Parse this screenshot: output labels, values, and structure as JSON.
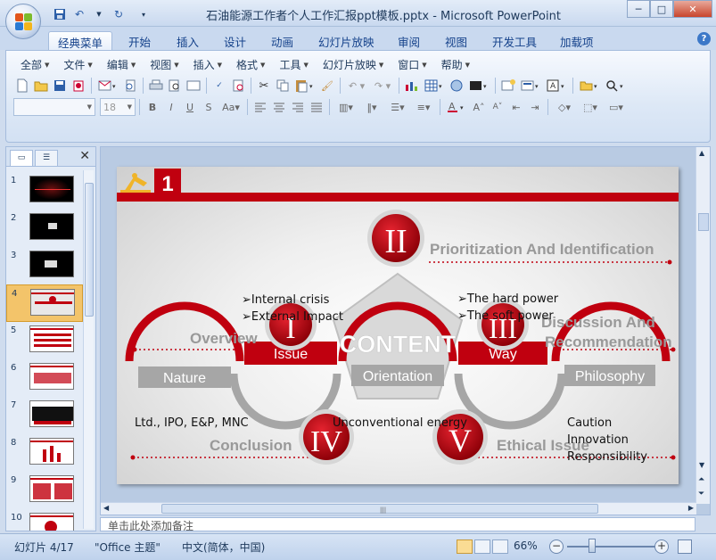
{
  "window": {
    "title": "石油能源工作者个人工作汇报ppt模板.pptx - Microsoft PowerPoint",
    "min_glyph": "─",
    "max_glyph": "□",
    "close_glyph": "✕"
  },
  "ribbon_tabs": [
    "经典菜单",
    "开始",
    "插入",
    "设计",
    "动画",
    "幻灯片放映",
    "审阅",
    "视图",
    "开发工具",
    "加载项"
  ],
  "active_tab": "经典菜单",
  "help_glyph": "?",
  "menus": [
    "全部",
    "文件",
    "编辑",
    "视图",
    "插入",
    "格式",
    "工具",
    "幻灯片放映",
    "窗口",
    "帮助"
  ],
  "font_size_value": "18",
  "thumbnails": {
    "numbers": [
      "1",
      "2",
      "3",
      "4",
      "5",
      "6",
      "7",
      "8",
      "9",
      "10"
    ],
    "selected": "4"
  },
  "slide": {
    "header_number": "1",
    "center_title": "CONTENT",
    "sections": [
      {
        "numeral": "I",
        "label": "Issue"
      },
      {
        "numeral": "II",
        "label": "Prioritization And Identification"
      },
      {
        "numeral": "III",
        "label": "Way"
      },
      {
        "numeral": "IV",
        "label": "Conclusion"
      },
      {
        "numeral": "V",
        "label": "Ethical Issue"
      }
    ],
    "boxes": [
      "Nature",
      "Orientation",
      "Philosophy"
    ],
    "overview": "Overview",
    "discussion": [
      "Discussion And",
      "Recommendation"
    ],
    "issue_bullets": [
      "➢Internal crisis",
      "➢External Impact"
    ],
    "way_bullets": [
      "➢The hard power",
      "➢The soft power"
    ],
    "nature_text": "Ltd., IPO, E&P, MNC",
    "orientation_text": "Unconventional energy",
    "philosophy_lines": [
      "Caution",
      "Innovation",
      "Responsibility"
    ],
    "colors": {
      "red": "#c0000f",
      "dark_red": "#a0000a",
      "gray_text": "#999999",
      "box_gray": "#a6a6a6"
    }
  },
  "notes_placeholder": "单击此处添加备注",
  "status": {
    "slide_info": "幻灯片 4/17",
    "theme": "\"Office 主题\"",
    "language": "中文(简体，中国)",
    "zoom": "66%",
    "zoom_minus": "−",
    "zoom_plus": "+"
  }
}
